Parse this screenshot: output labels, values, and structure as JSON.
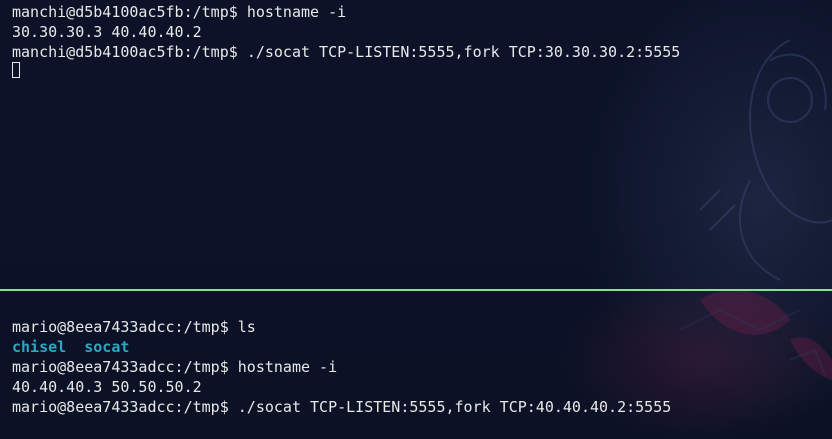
{
  "top_pane": {
    "lines": [
      {
        "prompt": "manchi@d5b4100ac5fb:/tmp$",
        "command": "hostname -i"
      },
      {
        "output": "30.30.30.3 40.40.40.2"
      },
      {
        "prompt": "manchi@d5b4100ac5fb:/tmp$",
        "command": "./socat TCP-LISTEN:5555,fork TCP:30.30.30.2:5555"
      }
    ]
  },
  "bottom_pane": {
    "lines": [
      {
        "prompt": "mario@8eea7433adcc:/tmp$",
        "command": "ls"
      },
      {
        "dirs": [
          "chisel",
          "socat"
        ]
      },
      {
        "prompt": "mario@8eea7433adcc:/tmp$",
        "command": "hostname -i"
      },
      {
        "output": "40.40.40.3 50.50.50.2"
      },
      {
        "prompt": "mario@8eea7433adcc:/tmp$",
        "command": "./socat TCP-LISTEN:5555,fork TCP:40.40.40.2:5555"
      }
    ]
  },
  "colors": {
    "background": "#0b1226",
    "text": "#e8e8e8",
    "directory": "#2aa8c4",
    "divider": "#7ee787"
  }
}
